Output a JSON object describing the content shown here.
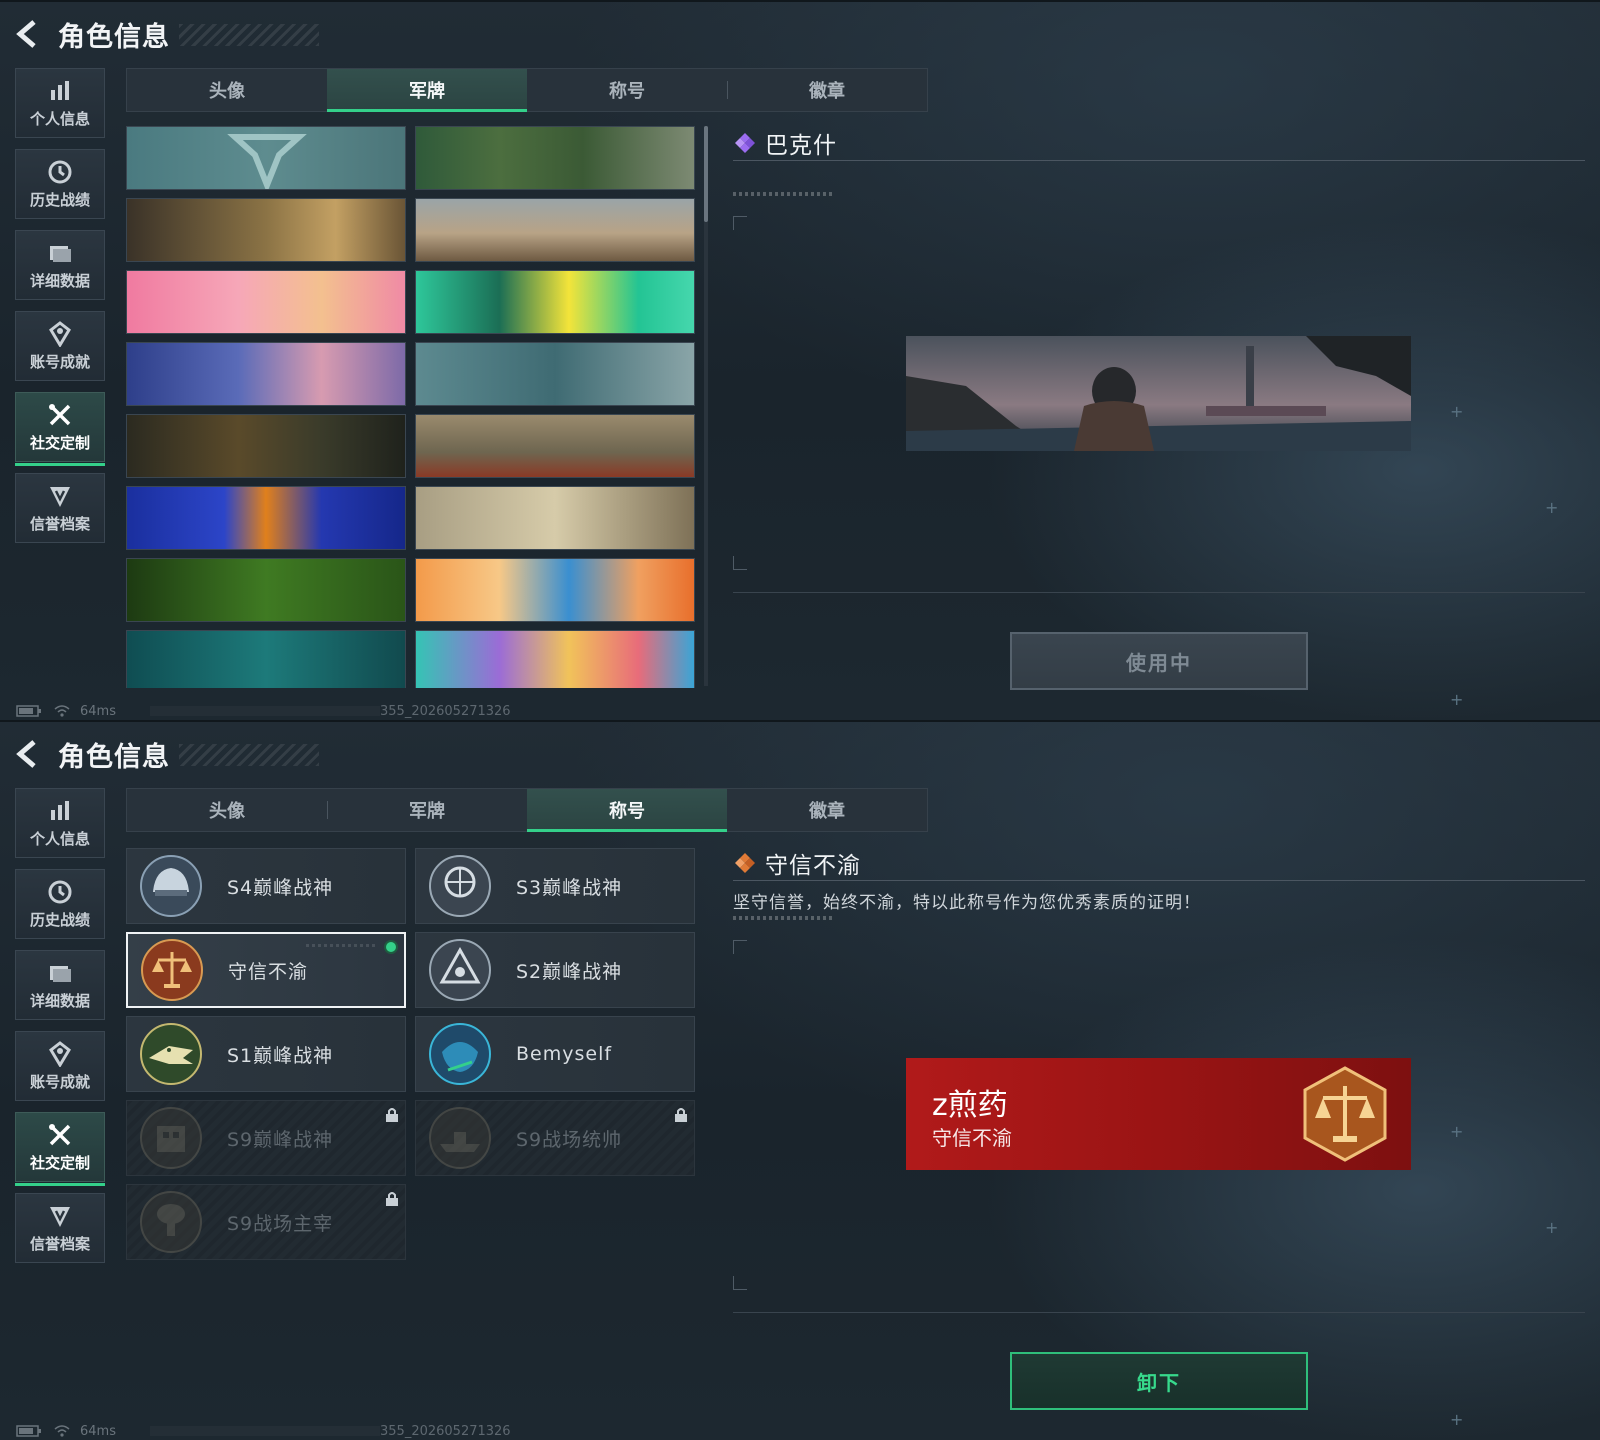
{
  "header": {
    "title": "角色信息"
  },
  "sidebar": {
    "items": [
      {
        "label": "个人信息",
        "icon": "bar-chart-icon"
      },
      {
        "label": "历史战绩",
        "icon": "clock-icon"
      },
      {
        "label": "详细数据",
        "icon": "folder-icon"
      },
      {
        "label": "账号成就",
        "icon": "achievement-icon"
      },
      {
        "label": "社交定制",
        "icon": "tools-icon",
        "active": true
      },
      {
        "label": "信誉档案",
        "icon": "shield-v-icon"
      }
    ]
  },
  "tabs": [
    "头像",
    "军牌",
    "称号",
    "徽章"
  ],
  "top_screen": {
    "active_tab": "军牌",
    "selected_item": {
      "name": "巴克什",
      "rarity_color": "#9b6cf0"
    },
    "button_label": "使用中",
    "banners": [
      {
        "theme": "teal-logo"
      },
      {
        "theme": "green-camo"
      },
      {
        "theme": "desert-soldiers"
      },
      {
        "theme": "desert-tank"
      },
      {
        "theme": "pink-cats"
      },
      {
        "theme": "green-cartoon"
      },
      {
        "theme": "blue-paratroopers"
      },
      {
        "theme": "teal-helicopters"
      },
      {
        "theme": "rifles-table"
      },
      {
        "theme": "poppy-aircraft"
      },
      {
        "theme": "blue-orange-face"
      },
      {
        "theme": "sniper-sunset"
      },
      {
        "theme": "green-night-vision"
      },
      {
        "theme": "orange-blue-art"
      },
      {
        "theme": "teal-gym"
      },
      {
        "theme": "anime-headphones"
      }
    ]
  },
  "bottom_screen": {
    "active_tab": "称号",
    "selected_item": {
      "name": "守信不渝",
      "description": "坚守信誉，始终不渝，特以此称号作为您优秀素质的证明！",
      "rarity_color": "#e07a36"
    },
    "preview": {
      "player_name": "z煎药",
      "title": "守信不渝"
    },
    "button_label": "卸下",
    "titles": [
      {
        "label": "S4巅峰战神",
        "emblem": "helmet-emblem-icon",
        "locked": false
      },
      {
        "label": "S3巅峰战神",
        "emblem": "globe-emblem-icon",
        "locked": false
      },
      {
        "label": "守信不渝",
        "emblem": "scales-emblem-icon",
        "locked": false,
        "selected": true
      },
      {
        "label": "S2巅峰战神",
        "emblem": "triangle-emblem-icon",
        "locked": false
      },
      {
        "label": "S1巅峰战神",
        "emblem": "crocodile-emblem-icon",
        "locked": false
      },
      {
        "label": "Bemyself",
        "emblem": "mask-emblem-icon",
        "locked": false
      },
      {
        "label": "S9巅峰战神",
        "emblem": "building-emblem-icon",
        "locked": true
      },
      {
        "label": "S9战场统帅",
        "emblem": "ship-emblem-icon",
        "locked": true
      },
      {
        "label": "S9战场主宰",
        "emblem": "explosion-emblem-icon",
        "locked": true
      }
    ]
  },
  "footer": {
    "ping": "64ms",
    "build": "355_202605271326"
  },
  "colors": {
    "accent": "#34d08a",
    "title_red": "#b11a1a"
  }
}
